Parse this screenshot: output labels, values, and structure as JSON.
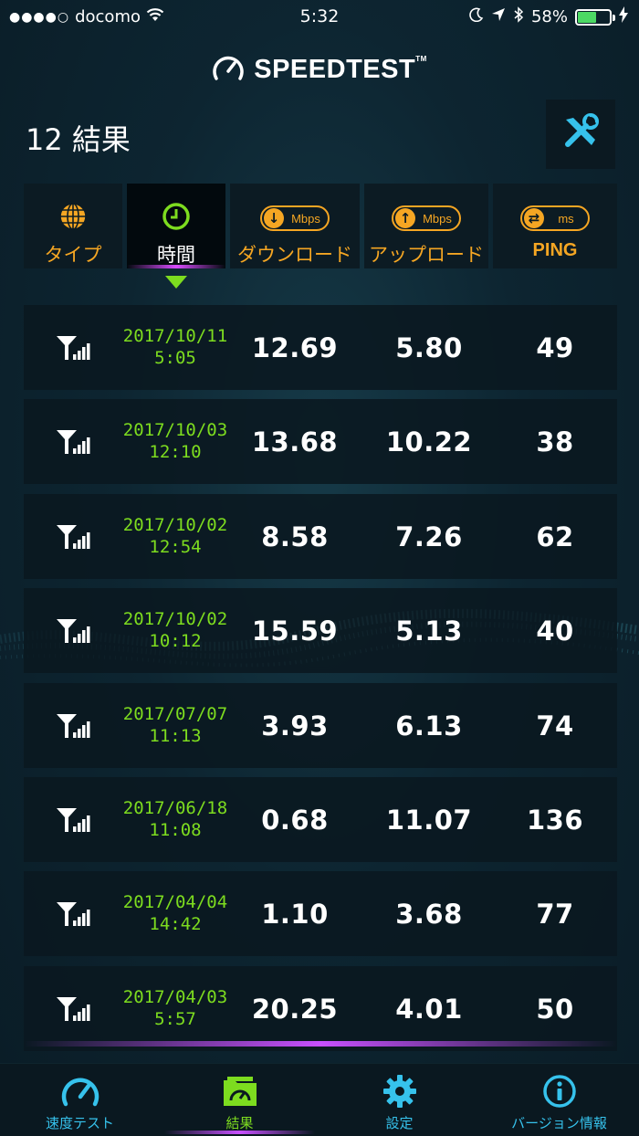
{
  "status_bar": {
    "signal_dots": "●●●●○",
    "carrier": "docomo",
    "time": "5:32",
    "battery_percent": "58%",
    "battery_level": 0.58
  },
  "app": {
    "logo_text": "SPEEDTEST",
    "logo_tm": "TM"
  },
  "page": {
    "title": "12 結果"
  },
  "columns": [
    {
      "label": "タイプ",
      "icon": "globe-icon",
      "active": false
    },
    {
      "label": "時間",
      "icon": "clock-icon",
      "active": true
    },
    {
      "label": "ダウンロード",
      "icon": "download-mbps-icon",
      "unit": "Mbps"
    },
    {
      "label": "アップロード",
      "icon": "upload-mbps-icon",
      "unit": "Mbps"
    },
    {
      "label": "PING",
      "icon": "ping-ms-icon",
      "unit": "ms"
    }
  ],
  "results": [
    {
      "date": "2017/10/11",
      "time": "5:05",
      "download": "12.69",
      "upload": "5.80",
      "ping": "49"
    },
    {
      "date": "2017/10/03",
      "time": "12:10",
      "download": "13.68",
      "upload": "10.22",
      "ping": "38"
    },
    {
      "date": "2017/10/02",
      "time": "12:54",
      "download": "8.58",
      "upload": "7.26",
      "ping": "62"
    },
    {
      "date": "2017/10/02",
      "time": "10:12",
      "download": "15.59",
      "upload": "5.13",
      "ping": "40"
    },
    {
      "date": "2017/07/07",
      "time": "11:13",
      "download": "3.93",
      "upload": "6.13",
      "ping": "74"
    },
    {
      "date": "2017/06/18",
      "time": "11:08",
      "download": "0.68",
      "upload": "11.07",
      "ping": "136"
    },
    {
      "date": "2017/04/04",
      "time": "14:42",
      "download": "1.10",
      "upload": "3.68",
      "ping": "77"
    },
    {
      "date": "2017/04/03",
      "time": "5:57",
      "download": "20.25",
      "upload": "4.01",
      "ping": "50"
    }
  ],
  "tabs": [
    {
      "label": "速度テスト",
      "icon": "speedometer-icon",
      "active": false
    },
    {
      "label": "結果",
      "icon": "results-folder-icon",
      "active": true
    },
    {
      "label": "設定",
      "icon": "gear-icon",
      "active": false
    },
    {
      "label": "バージョン情報",
      "icon": "info-icon",
      "active": false
    }
  ],
  "colors": {
    "accent_green": "#7ddc1f",
    "accent_orange": "#f5a623",
    "accent_cyan": "#36c2ec",
    "highlight_purple": "#c850ff",
    "background": "#0d2531"
  }
}
